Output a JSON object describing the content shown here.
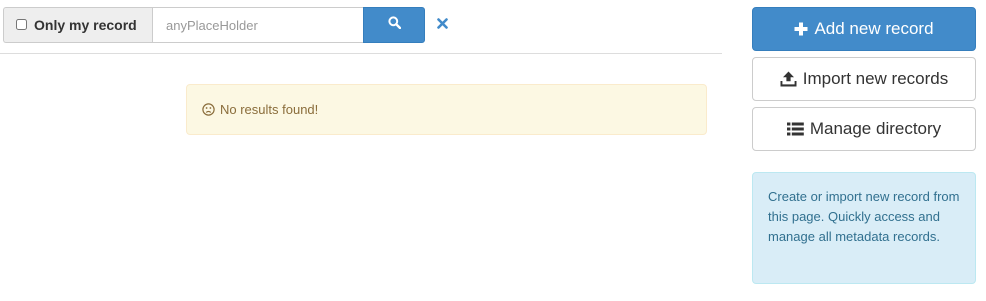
{
  "search": {
    "filter_label": "Only my record",
    "filter_checked": false,
    "placeholder": "anyPlaceHolder",
    "value": "",
    "search_icon": "search-icon",
    "clear_icon": "close-icon"
  },
  "results": {
    "empty_message": "No results found!",
    "empty_icon": "frown-icon"
  },
  "actions": {
    "add_label": "Add new record",
    "add_icon": "plus-icon",
    "import_label": "Import new records",
    "import_icon": "upload-icon",
    "manage_label": "Manage directory",
    "manage_icon": "list-icon"
  },
  "info": {
    "text": "Create or import new record from this page. Quickly access and manage all metadata records."
  },
  "colors": {
    "primary": "#428bca",
    "warning_bg": "#fcf8e3",
    "warning_text": "#8a6d3b",
    "info_bg": "#d9edf7",
    "info_text": "#31708f"
  }
}
